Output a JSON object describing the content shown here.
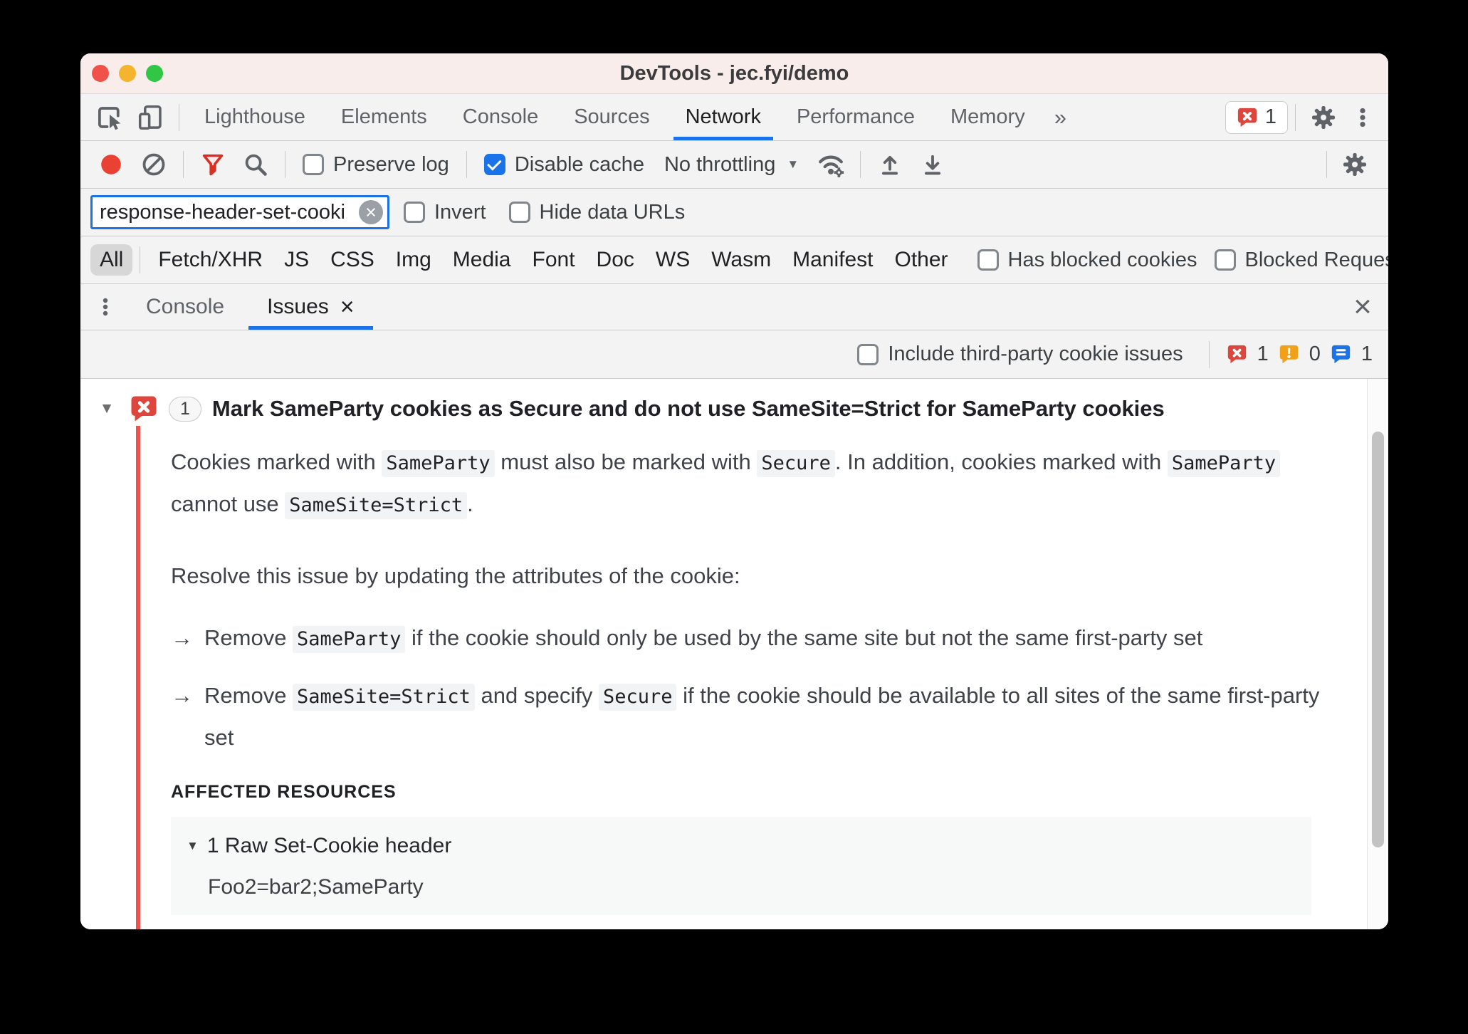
{
  "colors": {
    "accent_blue": "#1a73e8",
    "error_red": "#de453c",
    "warning_orange": "#f0a019",
    "info_blue": "#1a73e8",
    "record_red": "#e94235",
    "issue_line_red": "#ee544d",
    "titlebar_pink": "#f9edeb"
  },
  "window": {
    "title": "DevTools - jec.fyi/demo"
  },
  "icons": {
    "inspect": "cursor-in-box svg",
    "device_toolbar": "phone-tablet svg",
    "overflow_glyph": "»",
    "gear": "cog svg",
    "kebab": "three-vertical-dots",
    "record": "filled-red-circle",
    "clear": "circle-with-slash",
    "filter_funnel": "red funnel svg",
    "search": "magnifier svg",
    "network_conditions": "wifi-with-gear svg",
    "import": "up-arrow-over-bar svg",
    "export": "down-arrow-over-bar svg",
    "caret_glyph": "▼",
    "clear_field_glyph": "×",
    "close_glyph": "×",
    "expander_glyph": "▼",
    "bullet_arrow_glyph": "→",
    "error_badge": "red speech bubble with white x",
    "warning_badge": "orange speech bubble with white !",
    "info_badge": "blue speech bubble with white lines"
  },
  "main_tabs": {
    "items": [
      "Lighthouse",
      "Elements",
      "Console",
      "Sources",
      "Network",
      "Performance",
      "Memory"
    ],
    "active": "Network",
    "error_badge_count": "1"
  },
  "network_toolbar": {
    "preserve_log": "Preserve log",
    "disable_cache": "Disable cache",
    "throttling": "No throttling"
  },
  "filter_bar": {
    "value": "response-header-set-cooki",
    "invert": "Invert",
    "hide_data_urls": "Hide data URLs"
  },
  "type_filters": {
    "all": "All",
    "items": [
      "Fetch/XHR",
      "JS",
      "CSS",
      "Img",
      "Media",
      "Font",
      "Doc",
      "WS",
      "Wasm",
      "Manifest",
      "Other"
    ],
    "has_blocked_cookies": "Has blocked cookies",
    "blocked_requests": "Blocked Requests"
  },
  "drawer": {
    "console_tab": "Console",
    "issues_tab": "Issues",
    "active": "Issues"
  },
  "issues_toolbar": {
    "include_third_party": "Include third-party cookie issues",
    "error_count": "1",
    "warning_count": "0",
    "info_count": "1"
  },
  "issue": {
    "count": "1",
    "title": "Mark SameParty cookies as Secure and do not use SameSite=Strict for SameParty cookies",
    "description": [
      {
        "text": "Cookies marked with "
      },
      {
        "code": "SameParty"
      },
      {
        "text": " must also be marked with "
      },
      {
        "code": "Secure"
      },
      {
        "text": ". In addition, cookies marked with "
      },
      {
        "code": "SameParty"
      },
      {
        "text": " cannot use "
      },
      {
        "code": "SameSite=Strict"
      },
      {
        "text": "."
      }
    ],
    "resolution_intro": "Resolve this issue by updating the attributes of the cookie:",
    "resolutions": [
      {
        "segments": [
          {
            "text": "Remove "
          },
          {
            "code": "SameParty"
          },
          {
            "text": " if the cookie should only be used by the same site but not the same first-party set"
          }
        ]
      },
      {
        "segments": [
          {
            "text": "Remove "
          },
          {
            "code": "SameSite=Strict"
          },
          {
            "text": " and specify "
          },
          {
            "code": "Secure"
          },
          {
            "text": " if the cookie should be available to all sites of the same first-party set"
          }
        ]
      }
    ],
    "affected_resources_label": "AFFECTED RESOURCES",
    "resource_group": {
      "label": "1 Raw Set-Cookie header",
      "value": "Foo2=bar2;SameParty"
    }
  }
}
